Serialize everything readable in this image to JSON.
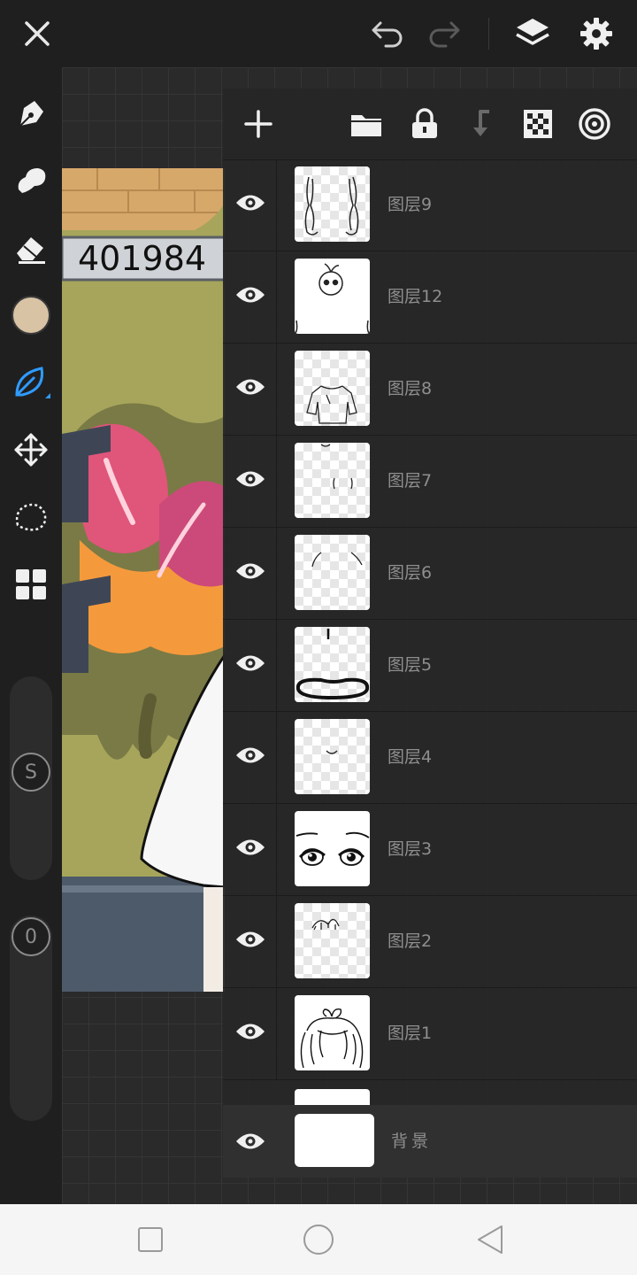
{
  "top_bar": {
    "icons": [
      "close-icon",
      "undo-icon",
      "redo-icon",
      "layers-icon",
      "settings-icon"
    ]
  },
  "left_toolbar": {
    "tools": [
      "pen-icon",
      "smudge-icon",
      "eraser-icon",
      "color-swatch",
      "leaf-brush-icon",
      "move-icon",
      "lasso-icon",
      "grid-menu-icon"
    ],
    "current_color": "#d8c3a5",
    "active_tool_color": "#2f9bff",
    "size_slider_label": "S",
    "opacity_slider_label": "0"
  },
  "artwork": {
    "score_text": "401984"
  },
  "layers_panel": {
    "header_icons": [
      "add-icon",
      "folder-icon",
      "lock-icon",
      "merge-down-icon",
      "transparency-icon",
      "blend-icon"
    ],
    "layers": [
      {
        "name": "图层9",
        "visible": true
      },
      {
        "name": "图层12",
        "visible": true
      },
      {
        "name": "图层8",
        "visible": true
      },
      {
        "name": "图层7",
        "visible": true
      },
      {
        "name": "图层6",
        "visible": true
      },
      {
        "name": "图层5",
        "visible": true
      },
      {
        "name": "图层4",
        "visible": true
      },
      {
        "name": "图层3",
        "visible": true
      },
      {
        "name": "图层2",
        "visible": true
      },
      {
        "name": "图层1",
        "visible": true
      }
    ],
    "background_layer": {
      "name": "背景",
      "visible": true
    }
  },
  "nav_bar": {
    "icons": [
      "recents-icon",
      "home-icon",
      "back-icon"
    ]
  }
}
